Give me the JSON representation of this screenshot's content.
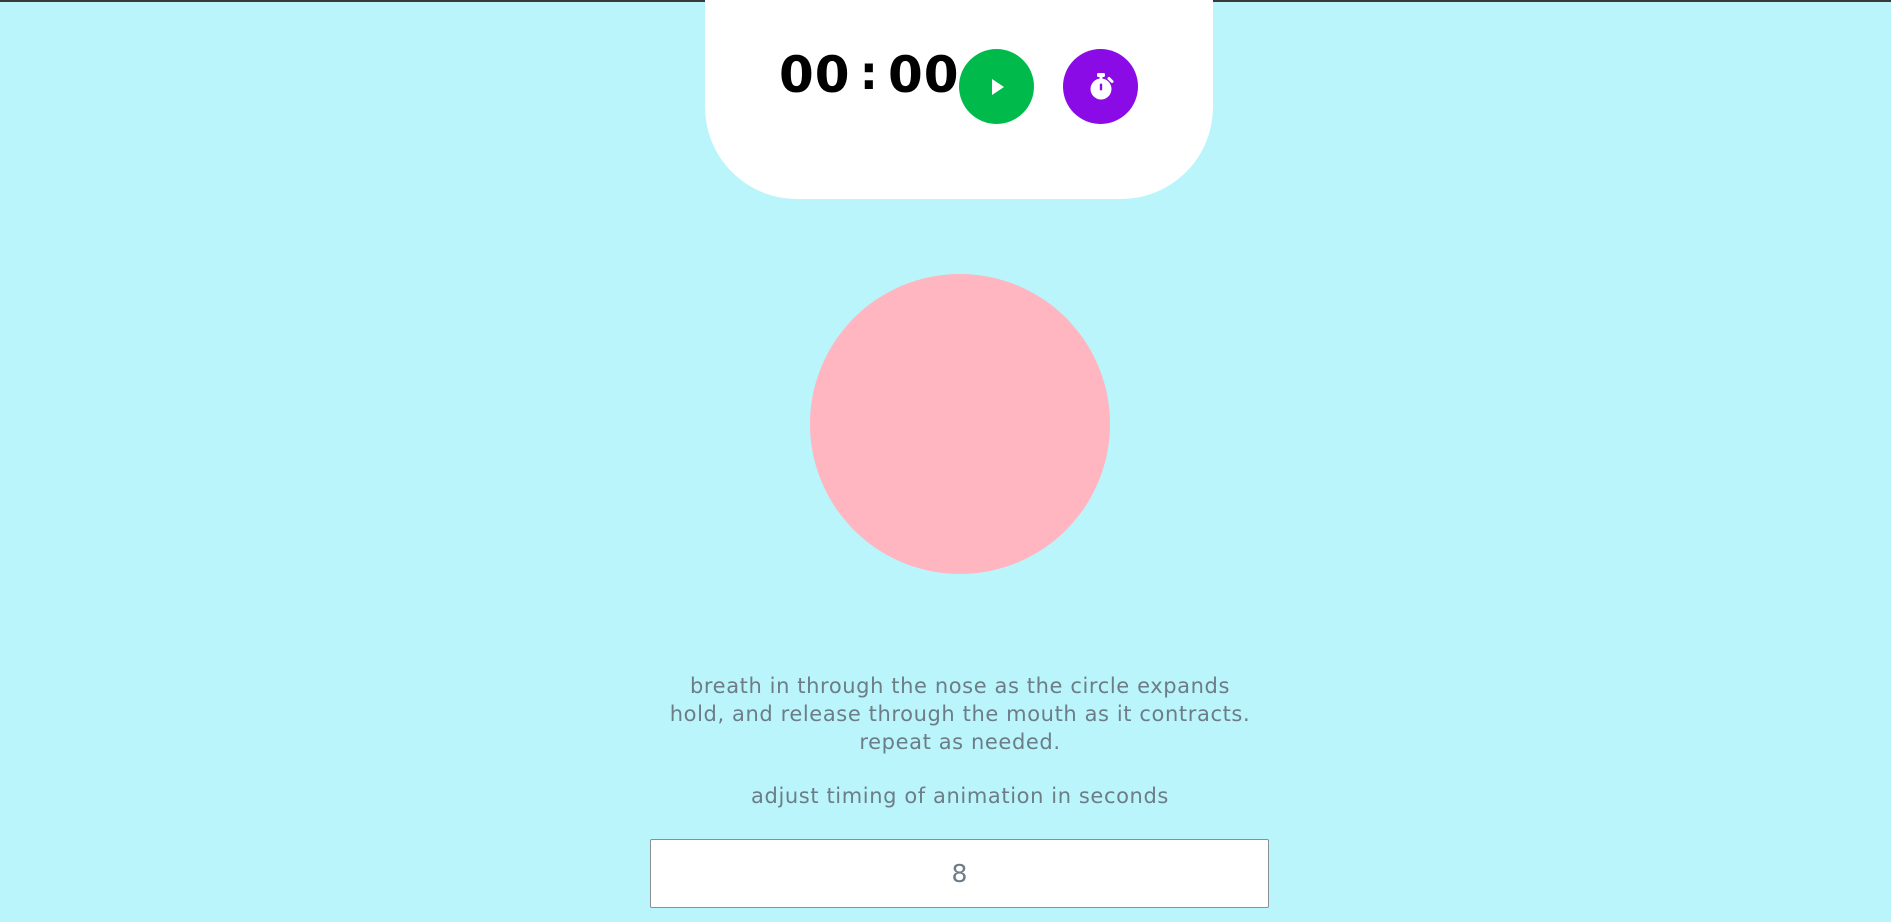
{
  "timer": {
    "minutes": "00",
    "separator": ":",
    "seconds": "00",
    "play_icon": "play-icon",
    "stopwatch_icon": "stopwatch-icon"
  },
  "colors": {
    "background": "#baf5fc",
    "panel": "#ffffff",
    "play_button": "#00bb4c",
    "stopwatch_button": "#8a0be6",
    "breath_circle": "#ffb6c0",
    "text": "#6c7d88"
  },
  "instructions": {
    "line1": "breath in through the nose as the circle expands",
    "line2": "hold, and release through the mouth as it contracts.",
    "line3": "repeat as needed."
  },
  "adjust": {
    "label": "adjust timing of animation in seconds",
    "value": "8"
  }
}
